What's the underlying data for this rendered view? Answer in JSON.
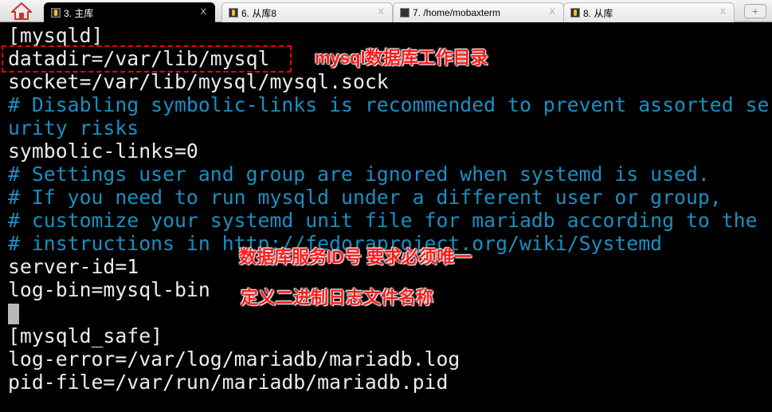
{
  "tabs": [
    {
      "label": "3. 主库",
      "active": true,
      "icon": "key-icon"
    },
    {
      "label": "6. 从库8",
      "active": false,
      "icon": "key-icon"
    },
    {
      "label": "7. /home/mobaxterm",
      "active": false,
      "icon": "terminal-icon"
    },
    {
      "label": "8. 从库",
      "active": false,
      "icon": "key-icon"
    }
  ],
  "tab_close": "X",
  "new_tab": "+",
  "lines": [
    {
      "text": "[mysqld]",
      "comment": false
    },
    {
      "text": "datadir=/var/lib/mysql",
      "comment": false
    },
    {
      "text": "socket=/var/lib/mysql/mysql.sock",
      "comment": false
    },
    {
      "text": "# Disabling symbolic-links is recommended to prevent assorted se",
      "comment": true
    },
    {
      "text": "urity risks",
      "comment": true
    },
    {
      "text": "symbolic-links=0",
      "comment": false
    },
    {
      "text": "# Settings user and group are ignored when systemd is used.",
      "comment": true
    },
    {
      "text": "# If you need to run mysqld under a different user or group,",
      "comment": true
    },
    {
      "text": "# customize your systemd unit file for mariadb according to the",
      "comment": true
    },
    {
      "text": "# instructions in http://fedoraproject.org/wiki/Systemd",
      "comment": true
    },
    {
      "text": "server-id=1",
      "comment": false
    },
    {
      "text": "log-bin=mysql-bin",
      "comment": false
    },
    {
      "text": "",
      "comment": false,
      "cursor": true
    },
    {
      "text": "[mysqld_safe]",
      "comment": false
    },
    {
      "text": "log-error=/var/log/mariadb/mariadb.log",
      "comment": false
    },
    {
      "text": "pid-file=/var/run/mariadb/mariadb.pid",
      "comment": false
    }
  ],
  "annotations": {
    "datadir": "mysql数据库工作目录",
    "server_id": "数据库服务ID号   要求必须唯一",
    "log_bin": "定义二进制日志文件名称"
  },
  "colors": {
    "comment": "#1a8fc0",
    "text": "#ececec",
    "annotation": "#ff1a1a"
  }
}
